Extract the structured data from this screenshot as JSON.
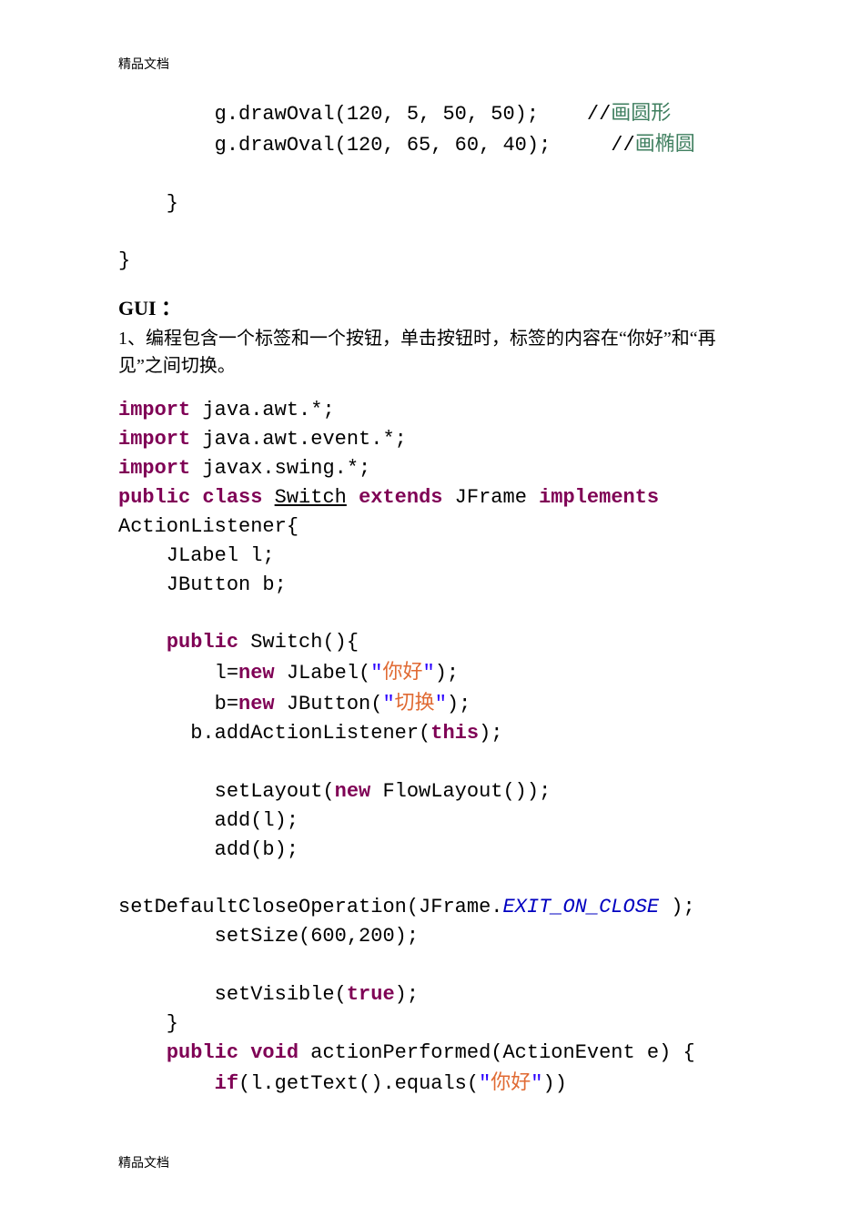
{
  "header": "精品文档",
  "footer": "精品文档",
  "code_top": {
    "l1_a": "        g.drawOval(120, 5, 50, 50);    ",
    "l1_b": "//",
    "l1_c": "画圆形",
    "l2_a": "        g.drawOval(120, 65, 60, 40);     ",
    "l2_b": "//",
    "l2_c": "画椭圆",
    "l3": "",
    "l4": "    }",
    "l5": "",
    "l6": "}"
  },
  "section": {
    "title": "GUI ：",
    "prose_a": "1",
    "prose_b": "、编程包含一个标签和一个按钮，单击按钮时，标签的内容在“你好”和“再见”之间切换。"
  },
  "code2": {
    "l1_kw": "import",
    "l1_rest": " java.awt.*;",
    "l2_kw": "import",
    "l2_rest": " java.awt.event.*;",
    "l3_kw": "import",
    "l3_rest": " javax.swing.*;",
    "l4_kw1": "public",
    "l4_sp1": " ",
    "l4_kw2": "class",
    "l4_sp2": " ",
    "l4_cls": "Switch",
    "l4_sp3": " ",
    "l4_kw3": "extends",
    "l4_sp4": " JFrame ",
    "l4_kw4": "implements",
    "l5": "ActionListener{",
    "l6": "    JLabel l;",
    "l7": "    JButton b;",
    "l8": "",
    "l9_ind": "    ",
    "l9_kw": "public",
    "l9_rest": " Switch(){",
    "l10_a": "        l=",
    "l10_kw": "new",
    "l10_b": " JLabel(",
    "l10_q1": "\"",
    "l10_str": "你好",
    "l10_q2": "\"",
    "l10_c": ");",
    "l11_a": "        b=",
    "l11_kw": "new",
    "l11_b": " JButton(",
    "l11_q1": "\"",
    "l11_str": "切换",
    "l11_q2": "\"",
    "l11_c": ");",
    "l12_a": "      b.addActionListener(",
    "l12_kw": "this",
    "l12_b": ");",
    "l13": "",
    "l14_a": "        setLayout(",
    "l14_kw": "new",
    "l14_b": " FlowLayout());",
    "l15": "        add(l);",
    "l16": "        add(b);",
    "l17": "",
    "l18_a": "setDefaultCloseOperation(JFrame.",
    "l18_const": "EXIT_ON_CLOSE",
    "l18_b": " );",
    "l19": "        setSize(600,200);",
    "l20": "",
    "l21_a": "        setVisible(",
    "l21_kw": "true",
    "l21_b": ");",
    "l22": "    }",
    "l23_ind": "    ",
    "l23_kw1": "public",
    "l23_sp": " ",
    "l23_kw2": "void",
    "l23_rest": " actionPerformed(ActionEvent e) {",
    "l24_ind": "        ",
    "l24_kw": "if",
    "l24_a": "(l.getText().equals(",
    "l24_q1": "\"",
    "l24_str": "你好",
    "l24_q2": "\"",
    "l24_b": "))"
  }
}
